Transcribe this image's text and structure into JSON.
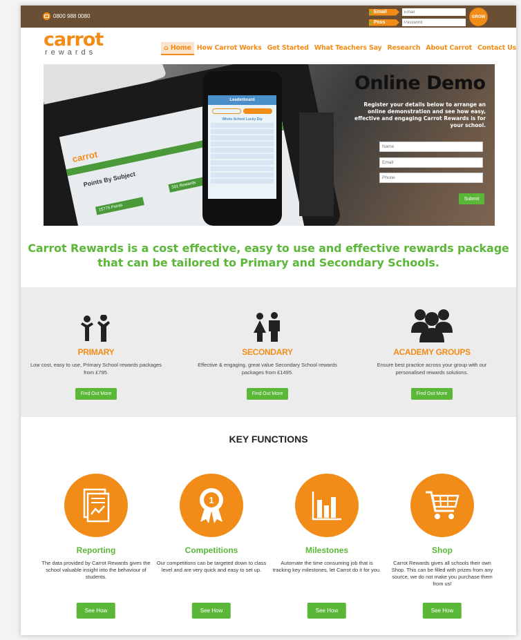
{
  "topbar": {
    "phone": "0800 988 0080",
    "email_label": "Email",
    "email_placeholder": "Email",
    "pass_label": "Pass",
    "pass_placeholder": "Password",
    "grow_label": "GROW"
  },
  "logo": {
    "word": "carrot",
    "sub": "rewards"
  },
  "nav": {
    "home": "Home",
    "how": "How Carrot Works",
    "start": "Get Started",
    "teachers": "What Teachers Say",
    "research": "Research",
    "about": "About Carrot",
    "contact": "Contact Us"
  },
  "hero": {
    "title": "Online Demo",
    "text": "Register your details below to arrange an online demonstration and see how easy, effective and engaging Carrot Rewards is for your school.",
    "name_placeholder": "Name",
    "email_placeholder": "Email",
    "phone_placeholder": "Phone",
    "submit": "Submit",
    "phone_app": {
      "header": "Leaderboard",
      "list_title": "Whole School Lucky Dip"
    },
    "tablet": {
      "logo": "carrot",
      "card1": "Points By Subject",
      "card2": "15775 Points",
      "card3": "301 Rewards"
    }
  },
  "tagline": "Carrot Rewards is a cost effective, easy to use and effective rewards package that can be tailored to Primary and Secondary Schools.",
  "schools": [
    {
      "title": "PRIMARY",
      "desc": "Low cost, easy to use, Primary School rewards packages from £795.",
      "button": "Find Out More",
      "icon": "children-icon"
    },
    {
      "title": "SECONDARY",
      "desc": "Effective & engaging, great value Secondary School rewards packages from £1495.",
      "button": "Find Out More",
      "icon": "students-icon"
    },
    {
      "title": "ACADEMY GROUPS",
      "desc": "Ensure best practice across your group with our personalised rewards solutions.",
      "button": "Find Out More",
      "icon": "group-icon"
    }
  ],
  "key_functions": {
    "title": "KEY FUNCTIONS",
    "items": [
      {
        "name": "Reporting",
        "desc": "The data provided by Carrot Rewards gives the school valuable insight into the behaviour of students.",
        "button": "See How",
        "icon": "report-icon"
      },
      {
        "name": "Competitions",
        "desc": "Our competitions can be targeted down to class level and are very quick and easy to set up.",
        "button": "See How",
        "icon": "medal-icon"
      },
      {
        "name": "Milestones",
        "desc": "Automate the time consuming job that is tracking key milestones, let Carrot do it for you.",
        "button": "See How",
        "icon": "bar-chart-icon"
      },
      {
        "name": "Shop",
        "desc": "Carrot Rewards gives all schools their own Shop. This can be filled with prizes from any source, we do not make you purchase them from us!",
        "button": "See How",
        "icon": "cart-icon"
      }
    ]
  },
  "colors": {
    "orange": "#f28c18",
    "green": "#5ab738",
    "brown": "#6b4f34"
  }
}
